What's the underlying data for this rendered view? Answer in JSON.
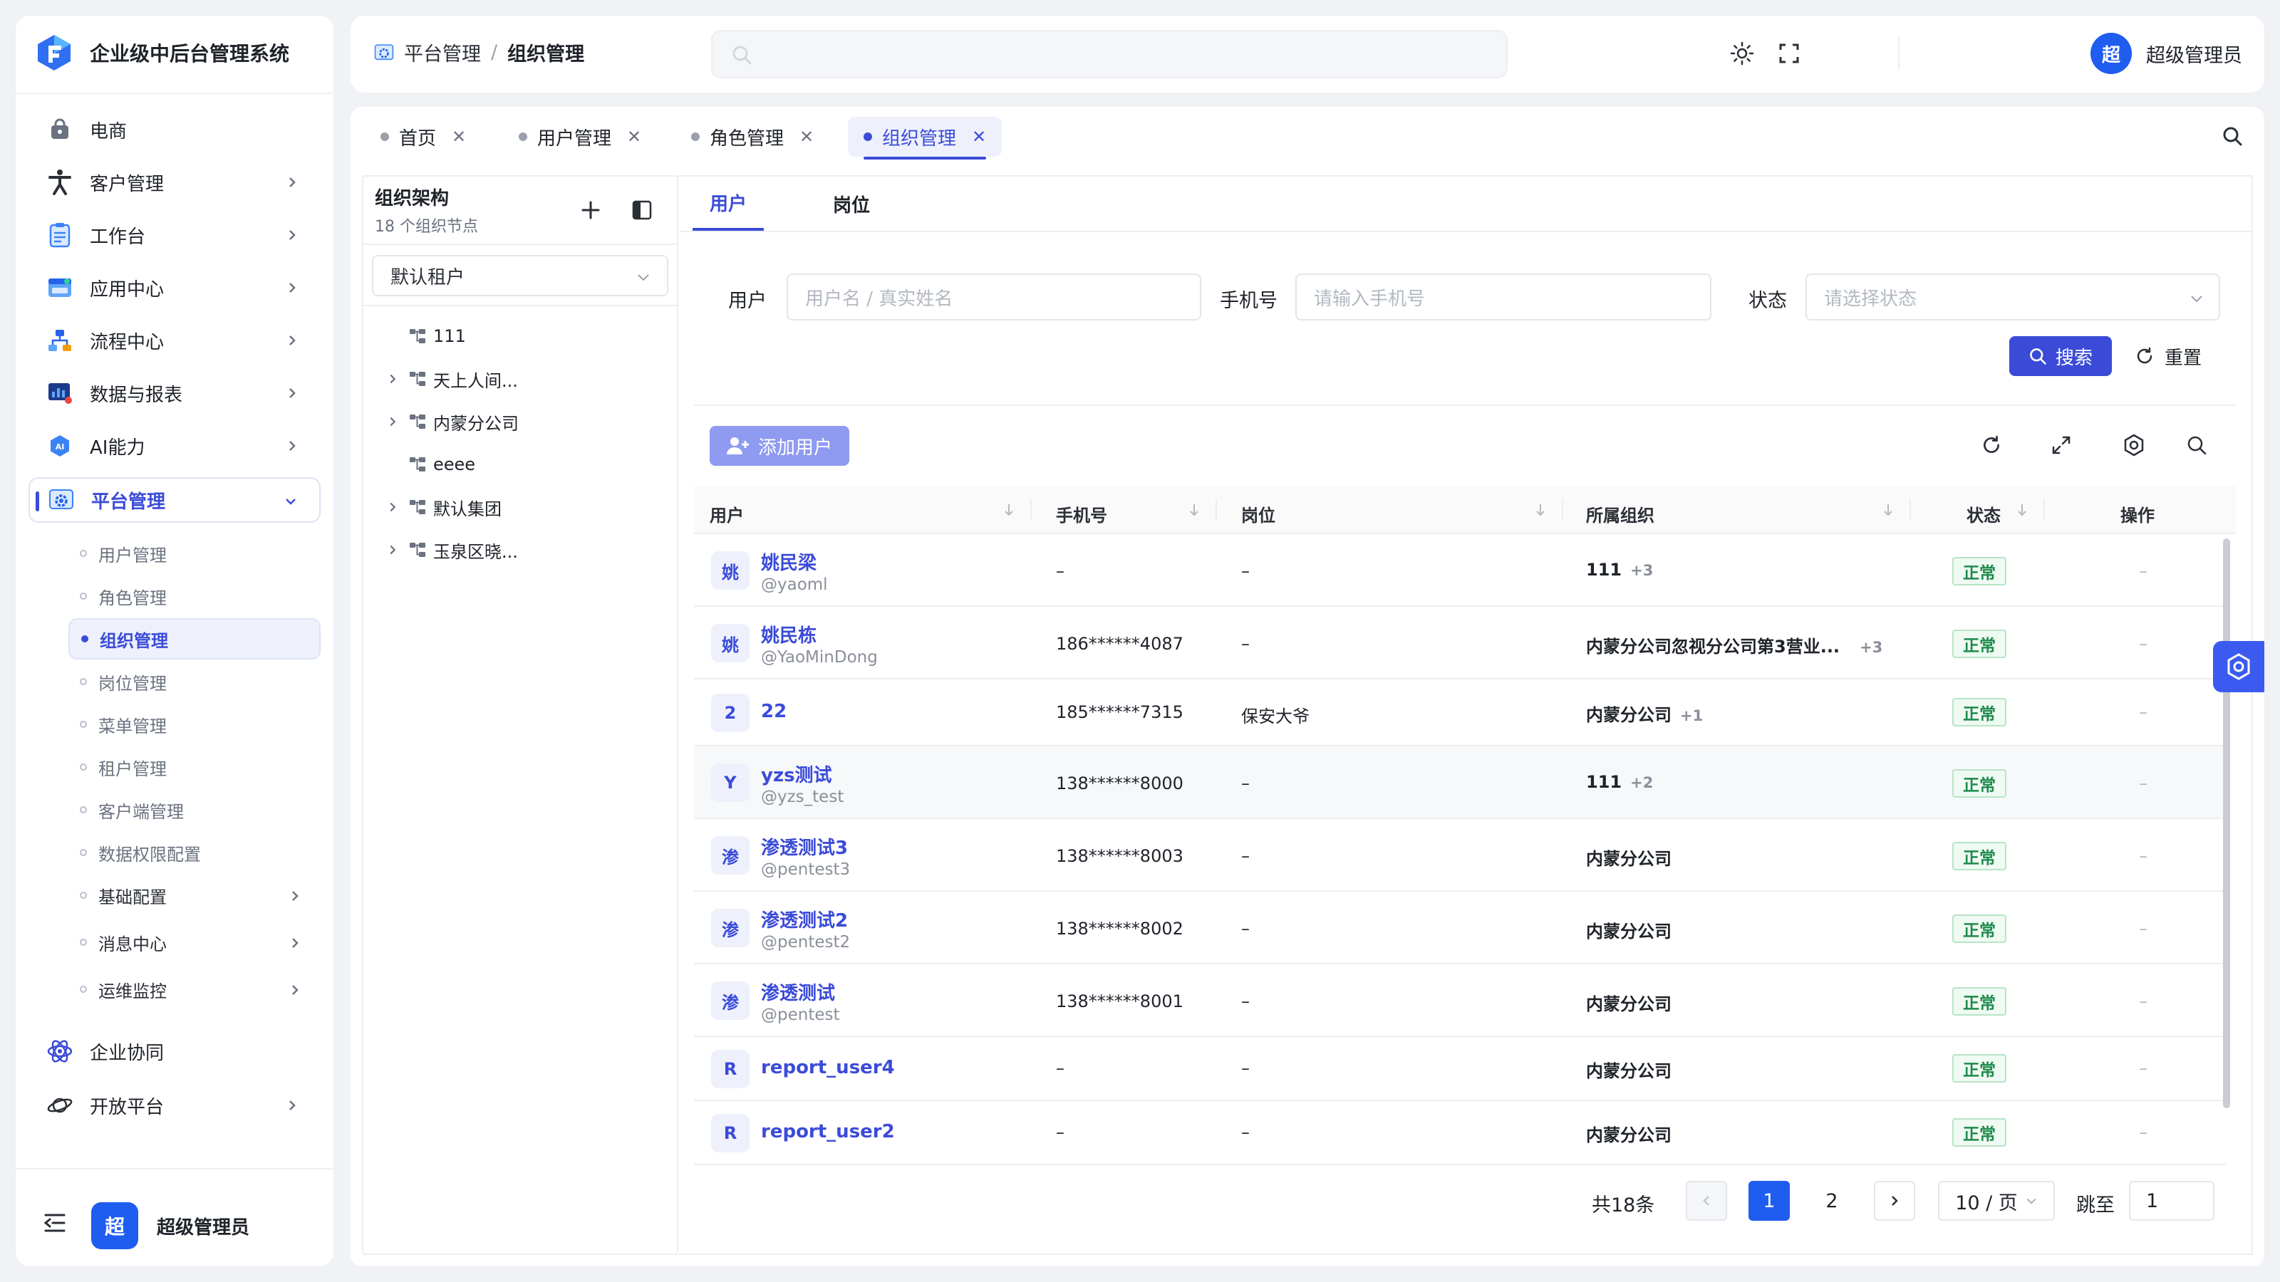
{
  "app": {
    "title": "企业级中后台管理系统"
  },
  "sidebar": {
    "menu": [
      {
        "label": "电商",
        "icon": "shopping-bag-icon"
      },
      {
        "label": "客户管理",
        "icon": "person-icon"
      },
      {
        "label": "工作台",
        "icon": "clipboard-icon"
      },
      {
        "label": "应用中心",
        "icon": "app-window-icon"
      },
      {
        "label": "流程中心",
        "icon": "flow-icon"
      },
      {
        "label": "数据与报表",
        "icon": "chart-screen-icon"
      },
      {
        "label": "AI能力",
        "icon": "ai-icon"
      },
      {
        "label": "平台管理",
        "icon": "platform-gear-icon"
      }
    ],
    "submenu": [
      {
        "label": "用户管理"
      },
      {
        "label": "角色管理"
      },
      {
        "label": "组织管理"
      },
      {
        "label": "岗位管理"
      },
      {
        "label": "菜单管理"
      },
      {
        "label": "租户管理"
      },
      {
        "label": "客户端管理"
      },
      {
        "label": "数据权限配置"
      },
      {
        "label": "基础配置"
      },
      {
        "label": "消息中心"
      },
      {
        "label": "运维监控"
      }
    ],
    "bottom_menu": [
      {
        "label": "企业协同",
        "icon": "atom-icon"
      },
      {
        "label": "开放平台",
        "icon": "planet-icon"
      }
    ],
    "user": {
      "avatar": "超",
      "name": "超级管理员"
    }
  },
  "header": {
    "breadcrumb": [
      "平台管理",
      "组织管理"
    ],
    "user": {
      "avatar": "超",
      "name": "超级管理员"
    }
  },
  "tabs": [
    {
      "label": "首页"
    },
    {
      "label": "用户管理"
    },
    {
      "label": "角色管理"
    },
    {
      "label": "组织管理"
    }
  ],
  "org": {
    "title": "组织架构",
    "count": "18 个组织节点",
    "tenant": "默认租户",
    "nodes": [
      {
        "label": "111"
      },
      {
        "label": "天上人间..."
      },
      {
        "label": "内蒙分公司"
      },
      {
        "label": "eeee"
      },
      {
        "label": "默认集团"
      },
      {
        "label": "玉泉区晓..."
      }
    ]
  },
  "main": {
    "tabs": [
      {
        "label": "用户"
      },
      {
        "label": "岗位"
      }
    ],
    "filters": {
      "user_label": "用户",
      "user_placeholder": "用户名 / 真实姓名",
      "phone_label": "手机号",
      "phone_placeholder": "请输入手机号",
      "status_label": "状态",
      "status_placeholder": "请选择状态",
      "search": "搜索",
      "reset": "重置"
    },
    "add_user": "添加用户",
    "columns": {
      "user": "用户",
      "phone": "手机号",
      "post": "岗位",
      "org": "所属组织",
      "status": "状态",
      "action": "操作"
    },
    "rows": [
      {
        "avatar": "姚",
        "name": "姚民梁",
        "handle": "@yaoml",
        "phone": "–",
        "post": "–",
        "org": "111",
        "org_more": "+3",
        "status": "正常",
        "op": "–"
      },
      {
        "avatar": "姚",
        "name": "姚民栋",
        "handle": "@YaoMinDong",
        "phone": "186******4087",
        "post": "–",
        "org": "内蒙分公司忽视分公司第3营业...",
        "org_more": "+3",
        "status": "正常",
        "op": "–"
      },
      {
        "avatar": "2",
        "name": "22",
        "handle": "",
        "phone": "185******7315",
        "post": "保安大爷",
        "org": "内蒙分公司",
        "org_more": "+1",
        "status": "正常",
        "op": "–"
      },
      {
        "avatar": "Y",
        "name": "yzs测试",
        "handle": "@yzs_test",
        "phone": "138******8000",
        "post": "–",
        "org": "111",
        "org_more": "+2",
        "status": "正常",
        "op": "–"
      },
      {
        "avatar": "渗",
        "name": "渗透测试3",
        "handle": "@pentest3",
        "phone": "138******8003",
        "post": "–",
        "org": "内蒙分公司",
        "org_more": "",
        "status": "正常",
        "op": "–"
      },
      {
        "avatar": "渗",
        "name": "渗透测试2",
        "handle": "@pentest2",
        "phone": "138******8002",
        "post": "–",
        "org": "内蒙分公司",
        "org_more": "",
        "status": "正常",
        "op": "–"
      },
      {
        "avatar": "渗",
        "name": "渗透测试",
        "handle": "@pentest",
        "phone": "138******8001",
        "post": "–",
        "org": "内蒙分公司",
        "org_more": "",
        "status": "正常",
        "op": "–"
      },
      {
        "avatar": "R",
        "name": "report_user4",
        "handle": "",
        "phone": "–",
        "post": "–",
        "org": "内蒙分公司",
        "org_more": "",
        "status": "正常",
        "op": "–"
      },
      {
        "avatar": "R",
        "name": "report_user2",
        "handle": "",
        "phone": "–",
        "post": "–",
        "org": "内蒙分公司",
        "org_more": "",
        "status": "正常",
        "op": "–"
      }
    ],
    "pagination": {
      "total": "共18条",
      "pages": [
        "1",
        "2"
      ],
      "page_size": "10 / 页",
      "jump_label": "跳至",
      "jump_value": "1"
    }
  },
  "colors": {
    "accent": "#3b4bd8",
    "success": "#1f8a4c",
    "avatar_blue": "#1f5cf0"
  }
}
